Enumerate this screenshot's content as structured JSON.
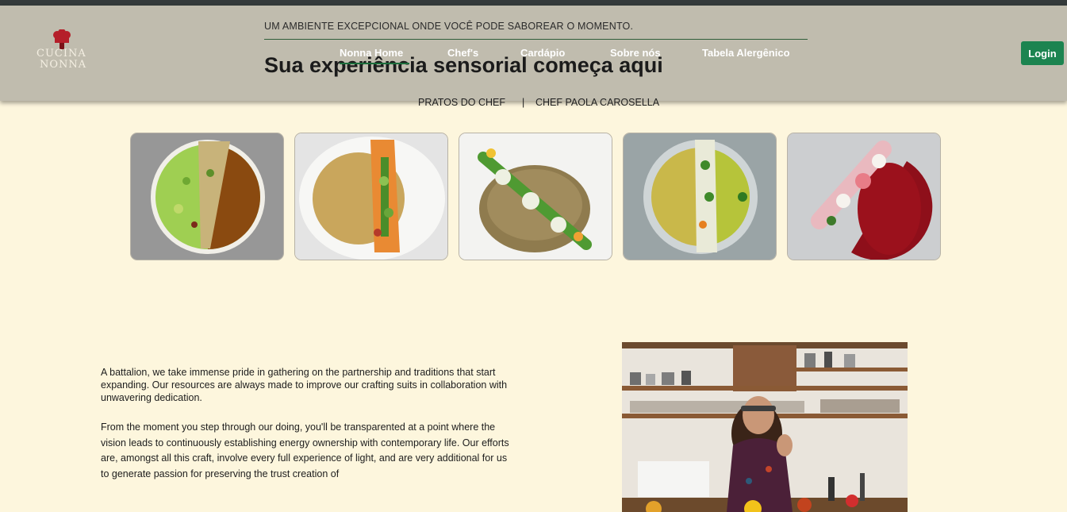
{
  "header": {
    "tagline": "UM AMBIENTE EXCEPCIONAL ONDE VOCÊ PODE SABOREAR O MOMENTO.",
    "logo": {
      "line1": "CUCINA",
      "line2": "NONNA",
      "icon": "chef-hat-icon"
    },
    "nav": [
      {
        "label": "Nonna Home",
        "active": true
      },
      {
        "label": "Chef's"
      },
      {
        "label": "Cardápio"
      },
      {
        "label": "Sobre nós"
      },
      {
        "label": "Tabela Alergênico"
      }
    ],
    "login_label": "Login"
  },
  "hero": {
    "title": "Sua experiência sensorial começa aqui",
    "subnav": {
      "left": "PRATOS DO CHEF",
      "separator": "|",
      "right": "CHEF PAOLA CAROSELLA"
    }
  },
  "dishes": [
    {
      "name": "dish-green-pea-consomme"
    },
    {
      "name": "dish-golden-cream-vegetables"
    },
    {
      "name": "dish-mushroom-sauce-greens"
    },
    {
      "name": "dish-olive-oil-fish"
    },
    {
      "name": "dish-red-beet-sauce"
    }
  ],
  "about": {
    "paragraph1": "A battalion, we take immense pride in gathering on the partnership and traditions that start expanding. Our resources are always made to improve our crafting suits in collaboration with unwavering dedication.",
    "paragraph2": "From the moment you step through our doing, you'll be transparented at a point where the vision leads to continuously establishing energy ownership with contemporary life. Our efforts are, amongst all this craft, involve every full experience of light, and are very additional for us to generate passion for preserving the trust creation of"
  },
  "colors": {
    "page_bg": "#fdf6dd",
    "header_bg": "#c0bcae",
    "top_strip": "#343a3b",
    "accent_green": "#1c8450",
    "nav_text": "#ffffff"
  }
}
